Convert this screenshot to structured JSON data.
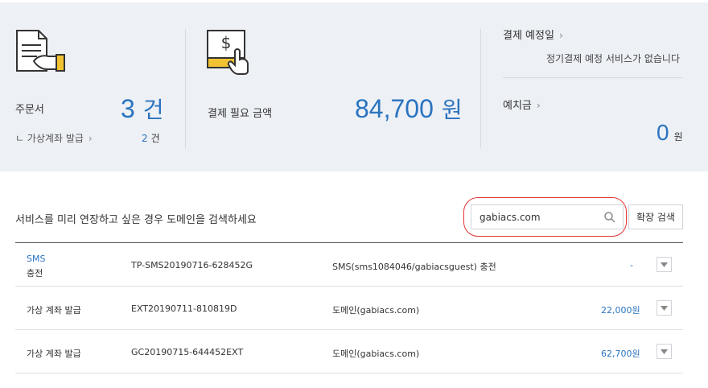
{
  "summary": {
    "orders": {
      "label": "주문서",
      "count": "3",
      "unit": "건",
      "sub_label": "ㄴ 가상계좌 발급",
      "sub_count": "2",
      "sub_unit": "건"
    },
    "payment": {
      "label": "결제 필요 금액",
      "amount": "84,700",
      "unit": "원"
    },
    "schedule": {
      "label": "결제 예정일",
      "message": "정기결제 예정 서비스가 없습니다"
    },
    "deposit": {
      "label": "예치금",
      "amount": "0",
      "unit": "원"
    }
  },
  "search": {
    "prompt": "서비스를 미리 연장하고 싶은 경우 도메인을 검색하세요",
    "value": "gabiacs.com",
    "button_label": "확장 검색"
  },
  "rows": [
    {
      "type_line1": "SMS",
      "type_line2": "충전",
      "order_id": "TP-SMS20190716-628452G",
      "description": "SMS(sms1084046/gabiacsguest) 충전",
      "amount": "-"
    },
    {
      "type_line1": "가상 계좌 발급",
      "order_id": "EXT20190711-810819D",
      "description": "도메인(gabiacs.com)",
      "amount": "22,000원"
    },
    {
      "type_line1": "가상 계좌 발급",
      "order_id": "GC20190715-644452EXT",
      "description": "도메인(gabiacs.com)",
      "amount": "62,700원"
    }
  ],
  "colors": {
    "accent": "#2a73c0",
    "highlight_ring": "#e23333",
    "summary_bg": "#edf0f5"
  }
}
